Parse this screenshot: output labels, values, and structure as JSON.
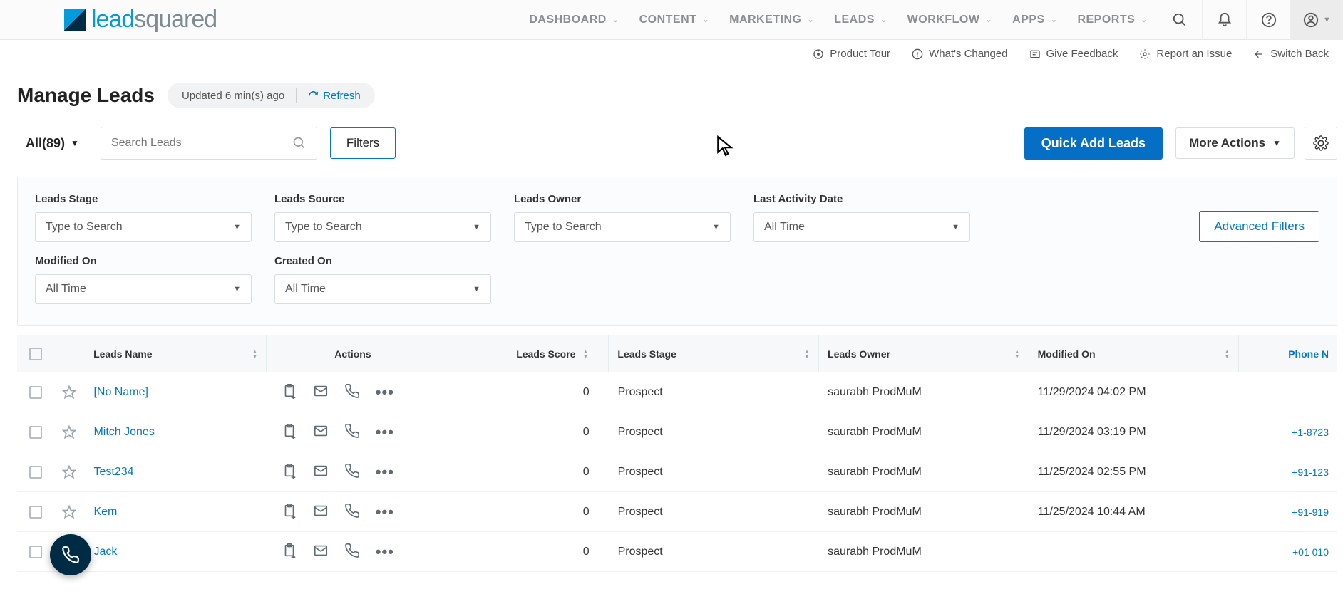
{
  "nav": {
    "items": [
      "DASHBOARD",
      "CONTENT",
      "MARKETING",
      "LEADS",
      "WORKFLOW",
      "APPS",
      "REPORTS"
    ]
  },
  "subbar": {
    "items": [
      "Product Tour",
      "What's Changed",
      "Give Feedback",
      "Report an Issue",
      "Switch Back"
    ]
  },
  "header": {
    "title": "Manage Leads",
    "updated": "Updated 6 min(s) ago",
    "refresh": "Refresh"
  },
  "toolbar": {
    "all": "All(89)",
    "search_ph": "Search Leads",
    "filters": "Filters",
    "quickadd": "Quick Add Leads",
    "more": "More Actions"
  },
  "filters": {
    "groups": [
      {
        "label": "Leads Stage",
        "value": "Type to Search"
      },
      {
        "label": "Leads Source",
        "value": "Type to Search"
      },
      {
        "label": "Leads Owner",
        "value": "Type to Search"
      },
      {
        "label": "Last Activity Date",
        "value": "All Time"
      },
      {
        "label": "Modified On",
        "value": "All Time"
      },
      {
        "label": "Created On",
        "value": "All Time"
      }
    ],
    "advanced": "Advanced Filters"
  },
  "table": {
    "cols": [
      "Leads Name",
      "Actions",
      "Leads Score",
      "Leads Stage",
      "Leads Owner",
      "Modified On",
      "Phone N"
    ],
    "rows": [
      {
        "name": "[No Name]",
        "score": "0",
        "stage": "Prospect",
        "owner": "saurabh ProdMuM",
        "mod": "11/29/2024 04:02 PM",
        "phone": ""
      },
      {
        "name": "Mitch Jones",
        "score": "0",
        "stage": "Prospect",
        "owner": "saurabh ProdMuM",
        "mod": "11/29/2024 03:19 PM",
        "phone": "+1-8723"
      },
      {
        "name": "Test234",
        "score": "0",
        "stage": "Prospect",
        "owner": "saurabh ProdMuM",
        "mod": "11/25/2024 02:55 PM",
        "phone": "+91-123"
      },
      {
        "name": "Kem",
        "score": "0",
        "stage": "Prospect",
        "owner": "saurabh ProdMuM",
        "mod": "11/25/2024 10:44 AM",
        "phone": "+91-919"
      },
      {
        "name": "Jack",
        "score": "0",
        "stage": "Prospect",
        "owner": "saurabh ProdMuM",
        "mod": "",
        "phone": "+01 010"
      }
    ]
  }
}
